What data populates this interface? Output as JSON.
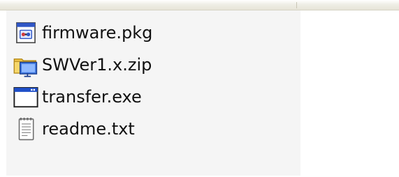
{
  "file_list": {
    "items": [
      {
        "name": "firmware.pkg",
        "icon": "package-file-icon"
      },
      {
        "name": "SWVer1.x.zip",
        "icon": "zip-folder-icon"
      },
      {
        "name": "transfer.exe",
        "icon": "application-window-icon"
      },
      {
        "name": "readme.txt",
        "icon": "text-document-icon"
      }
    ]
  },
  "colors": {
    "pane_background": "#f5f5f5",
    "text": "#111111",
    "folder_yellow": "#f3c64a",
    "titlebar_blue": "#1f4fc8"
  }
}
